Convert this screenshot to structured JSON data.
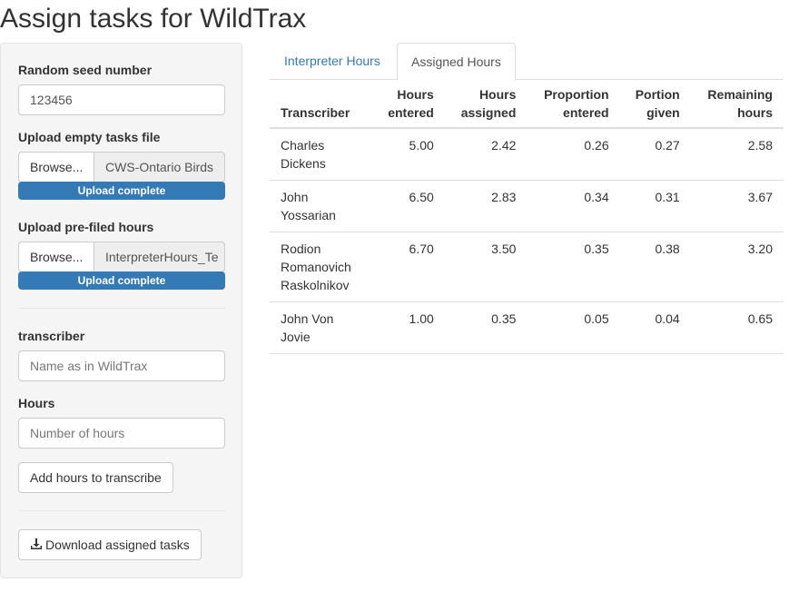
{
  "page": {
    "title": "Assign tasks for WildTrax"
  },
  "sidebar": {
    "seed": {
      "label": "Random seed number",
      "value": "123456"
    },
    "empty_tasks": {
      "label": "Upload empty tasks file",
      "browse_label": "Browse...",
      "file_name": "CWS-Ontario Birds",
      "progress_label": "Upload complete",
      "progress": 1.0
    },
    "prefiled_hours": {
      "label": "Upload pre-filed hours",
      "browse_label": "Browse...",
      "file_name": "InterpreterHours_Te",
      "progress_label": "Upload complete",
      "progress": 1.0
    },
    "transcriber": {
      "label": "transcriber",
      "placeholder": "Name as in WildTrax",
      "value": ""
    },
    "hours": {
      "label": "Hours",
      "placeholder": "Number of hours",
      "value": ""
    },
    "add_button_label": "Add hours to transcribe",
    "download_button_label": "Download assigned tasks",
    "download_icon": "download-icon"
  },
  "tabs": [
    {
      "label": "Interpreter Hours",
      "active": false
    },
    {
      "label": "Assigned Hours",
      "active": true
    }
  ],
  "table": {
    "headers": [
      [
        "",
        "Transcriber"
      ],
      [
        "Hours",
        "entered"
      ],
      [
        "Hours",
        "assigned"
      ],
      [
        "Proportion",
        "entered"
      ],
      [
        "Portion",
        "given"
      ],
      [
        "Remaining",
        "hours"
      ]
    ],
    "rows": [
      {
        "name": [
          "Charles",
          "Dickens"
        ],
        "hours_entered": "5.00",
        "hours_assigned": "2.42",
        "proportion_entered": "0.26",
        "portion_given": "0.27",
        "remaining_hours": "2.58"
      },
      {
        "name": [
          "John",
          "Yossarian"
        ],
        "hours_entered": "6.50",
        "hours_assigned": "2.83",
        "proportion_entered": "0.34",
        "portion_given": "0.31",
        "remaining_hours": "3.67"
      },
      {
        "name": [
          "Rodion",
          "Romanovich",
          "Raskolnikov"
        ],
        "hours_entered": "6.70",
        "hours_assigned": "3.50",
        "proportion_entered": "0.35",
        "portion_given": "0.38",
        "remaining_hours": "3.20"
      },
      {
        "name": [
          "John Von",
          "Jovie"
        ],
        "hours_entered": "1.00",
        "hours_assigned": "0.35",
        "proportion_entered": "0.05",
        "portion_given": "0.04",
        "remaining_hours": "0.65"
      }
    ]
  },
  "colors": {
    "accent": "#337ab7",
    "sidebar_bg": "#f5f5f5",
    "border": "#dddddd"
  }
}
